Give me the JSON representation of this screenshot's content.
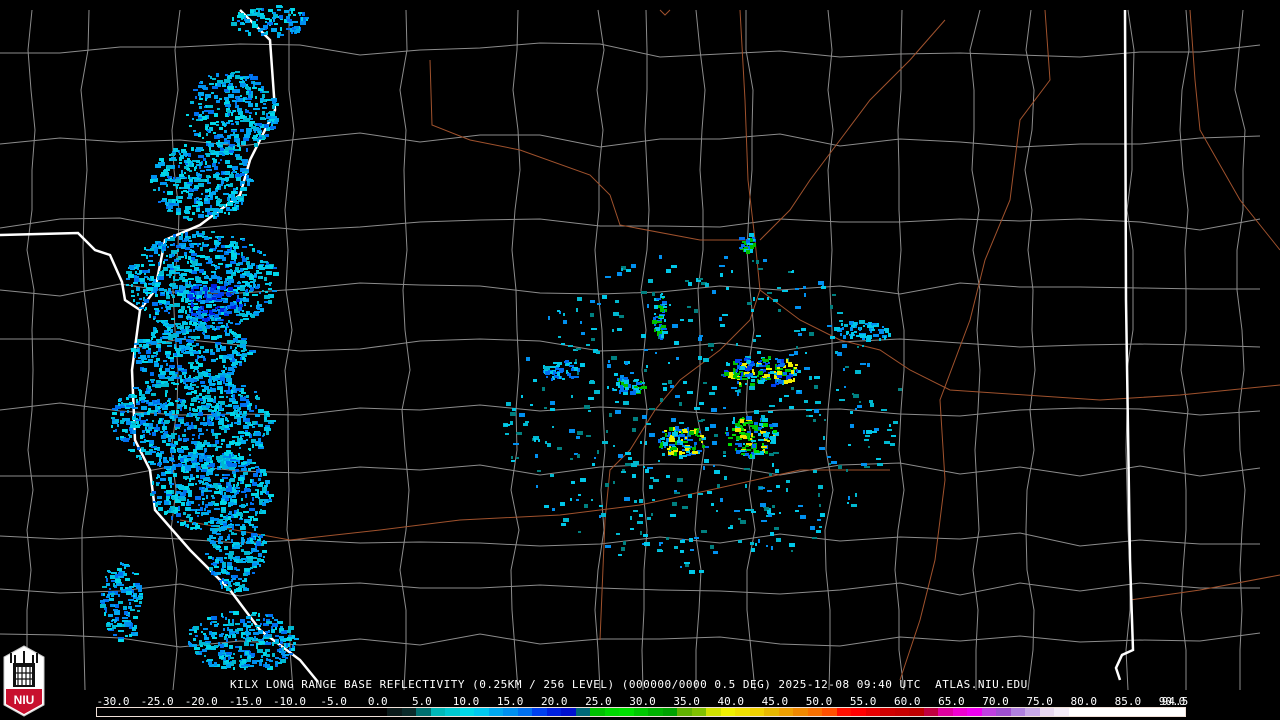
{
  "product_title": "KILX LONG RANGE BASE REFLECTIVITY (0.25KM / 256 LEVEL) (000000/0000 0.5 DEG) 2025-12-08 09:40 UTC  ATLAS.NIU.EDU",
  "logo": {
    "text": "NIU"
  },
  "legend": {
    "labels": [
      "-30.0",
      "-25.0",
      "-20.0",
      "-15.0",
      "-10.0",
      "-5.0",
      "0.0",
      "5.0",
      "10.0",
      "15.0",
      "20.0",
      "25.0",
      "30.0",
      "35.0",
      "40.0",
      "45.0",
      "50.0",
      "55.0",
      "60.0",
      "65.0",
      "70.0",
      "75.0",
      "80.0",
      "85.0",
      "90.0",
      "94.5"
    ],
    "colors": [
      "#000000",
      "#000000",
      "#000000",
      "#000000",
      "#000000",
      "#000000",
      "#000000",
      "#000000",
      "#000000",
      "#000000",
      "#000000",
      "#000000",
      "#000000",
      "#000000",
      "#000000",
      "#000000",
      "#000000",
      "#000000",
      "#000000",
      "#000000",
      "#0a1a1a",
      "#0a2a2a",
      "#007070",
      "#00b8b8",
      "#00c8d0",
      "#00d8e8",
      "#00c8f0",
      "#00a8f0",
      "#0090f0",
      "#0070f0",
      "#0040f0",
      "#0020e0",
      "#0010d0",
      "#006878",
      "#00c000",
      "#00d800",
      "#00e000",
      "#00c800",
      "#00b000",
      "#00a000",
      "#60b000",
      "#80c000",
      "#d0e000",
      "#f0f000",
      "#f0e000",
      "#f0d000",
      "#e8b800",
      "#f0a000",
      "#f08800",
      "#f87000",
      "#ff5000",
      "#ff1000",
      "#ff0000",
      "#e80000",
      "#d00000",
      "#c80000",
      "#c00000",
      "#c00040",
      "#e000a0",
      "#f000d0",
      "#f000f0",
      "#c040e0",
      "#a050d0",
      "#b080e0",
      "#c8a8e8",
      "#e8d8f0",
      "#f4ecf8",
      "#ffffff",
      "#ffffff",
      "#ffffff",
      "#ffffff",
      "#ffffff",
      "#ffffff",
      "#ffffff",
      "#ffffff"
    ]
  }
}
